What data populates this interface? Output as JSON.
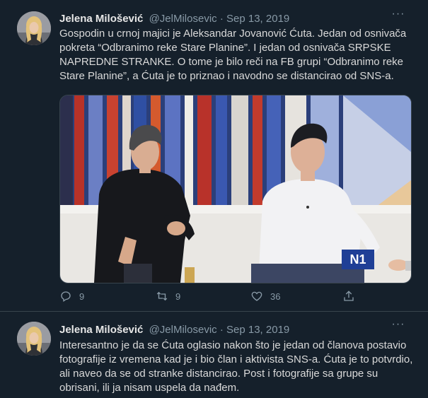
{
  "tweets": [
    {
      "author_name": "Jelena Milošević",
      "handle": "@JelMilosevic",
      "separator": " · ",
      "date": "Sep 13, 2019",
      "text": "Gospodin u crnoj majici je Aleksandar Jovanović Ćuta. Jedan od osnivača pokreta “Odbranimo reke Stare Planine”. I jedan od osnivača SRPSKE NAPREDNE STRANKE. O tome je bilo reči na FB grupi “Odbranimo reke Stare Planine”, a Ćuta je to priznao i navodno se distancirao od SNS-a.",
      "media": {
        "channel_logo": "N1"
      },
      "actions": {
        "reply_count": "9",
        "retweet_count": "9",
        "like_count": "36"
      }
    },
    {
      "author_name": "Jelena Milošević",
      "handle": "@JelMilosevic",
      "separator": " · ",
      "date": "Sep 13, 2019",
      "text": "Interesantno je da se Ćuta oglasio nakon što je jedan od članova postavio fotografije iz vremena kad je i bio član i aktivista SNS-a. Ćuta je to potvrdio, ali naveo da se od stranke distancirao. Post i fotografije sa grupe su obrisani, ili ja nisam uspela da nađem."
    }
  ],
  "icons": [
    "more-icon",
    "reply-icon",
    "retweet-icon",
    "like-icon",
    "share-icon"
  ],
  "colors": {
    "background": "#15202b",
    "secondary_text": "#8899a6",
    "primary_text": "#d9d9d9"
  }
}
